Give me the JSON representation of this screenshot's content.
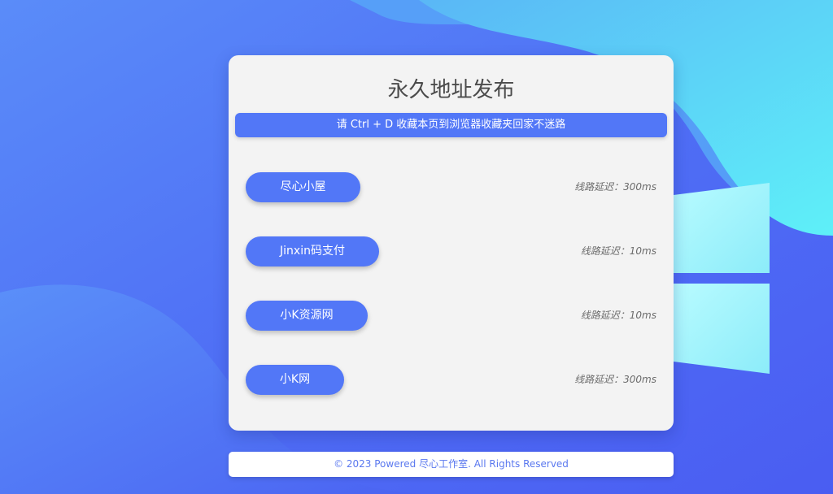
{
  "page": {
    "title": "永久地址发布",
    "notice": "请 Ctrl + D 收藏本页到浏览器收藏夹回家不迷路"
  },
  "links": [
    {
      "label": "尽心小屋",
      "latency": "线路延迟：300ms"
    },
    {
      "label": "Jinxin码支付",
      "latency": "线路延迟：10ms"
    },
    {
      "label": "小K资源网",
      "latency": "线路延迟：10ms"
    },
    {
      "label": "小K网",
      "latency": "线路延迟：300ms"
    }
  ],
  "footer": {
    "text": "© 2023 Powered 尽心工作室. All Rights Reserved"
  },
  "colors": {
    "accent": "#5277f7",
    "background_blue": "#4a5ff3",
    "background_cyan": "#5fe4f8",
    "card": "#f3f3f3"
  }
}
